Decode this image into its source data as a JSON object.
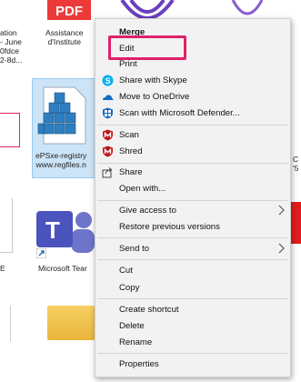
{
  "desktop": {
    "files": [
      {
        "label": "Assistance\nd'Institute"
      },
      {
        "label": "ation\n- June\n0fdce\n2-8d..."
      },
      {
        "label": "ePSxe-registry\nwww.regfiles.n"
      },
      {
        "label": "Microsoft Tear"
      },
      {
        "label": "E"
      },
      {
        "label": "C\n'5"
      }
    ],
    "badges": {
      "pdf": "PDF"
    }
  },
  "menu": {
    "items": [
      {
        "label": "Merge",
        "bold": true
      },
      {
        "label": "Edit"
      },
      {
        "label": "Print"
      },
      {
        "label": "Share with Skype",
        "icon": "skype-icon"
      },
      {
        "label": "Move to OneDrive",
        "icon": "onedrive-icon"
      },
      {
        "label": "Scan with Microsoft Defender...",
        "icon": "defender-shield-icon"
      },
      {
        "label": "Scan",
        "icon": "mcafee-icon"
      },
      {
        "label": "Shred",
        "icon": "mcafee-shred-icon"
      },
      {
        "label": "Share",
        "icon": "share-icon"
      },
      {
        "label": "Open with..."
      },
      {
        "label": "Give access to",
        "submenu": true
      },
      {
        "label": "Restore previous versions"
      },
      {
        "label": "Send to",
        "submenu": true
      },
      {
        "label": "Cut"
      },
      {
        "label": "Copy"
      },
      {
        "label": "Create shortcut"
      },
      {
        "label": "Delete"
      },
      {
        "label": "Rename"
      },
      {
        "label": "Properties"
      }
    ]
  },
  "colors": {
    "highlight": "#e0206a",
    "skype": "#00aff0",
    "onedrive": "#0f6cbd",
    "defender": "#1565c0",
    "mcafee": "#c01818"
  }
}
